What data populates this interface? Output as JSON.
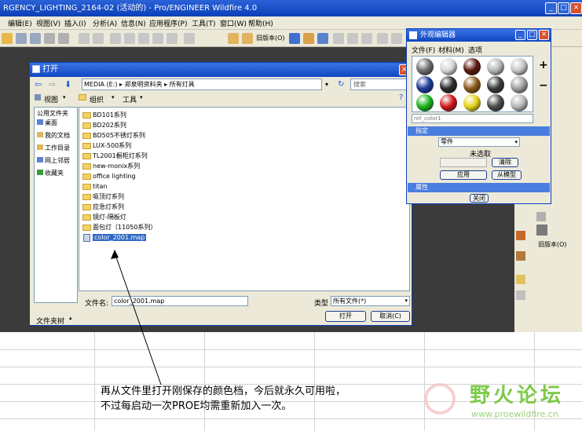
{
  "window": {
    "title": "RGENCY_LIGHTING_2164-02 (活动的) - Pro/ENGINEER Wildfire 4.0"
  },
  "menubar": [
    "编辑(E)",
    "视图(V)",
    "插入(I)",
    "分析(A)",
    "信息(N)",
    "应用程序(P)",
    "工具(T)",
    "窗口(W)",
    "帮助(H)"
  ],
  "toolbar": {
    "old_version_label": "旧版本(O)"
  },
  "open_dialog": {
    "title": "打开",
    "path": [
      "MEDIA (E:)",
      "郑泉明资料夹",
      "所有灯具"
    ],
    "search_placeholder": "搜索",
    "view_label": "视图",
    "organize_label": "组织",
    "tools_label": "工具",
    "sidebar_heading": "公用文件夹",
    "sidebar_items": [
      "桌面",
      "我的文档",
      "工作目录",
      "网上邻居",
      "收藏夹"
    ],
    "folder_tree_label": "文件夹树",
    "files": [
      {
        "name": "BD101系列",
        "type": "folder"
      },
      {
        "name": "BD202系列",
        "type": "folder"
      },
      {
        "name": "BD505不锈灯系列",
        "type": "folder"
      },
      {
        "name": "LUX-500系列",
        "type": "folder"
      },
      {
        "name": "TL2001橱柜灯系列",
        "type": "folder"
      },
      {
        "name": "new-monix系列",
        "type": "folder"
      },
      {
        "name": "office lighting",
        "type": "folder"
      },
      {
        "name": "titan",
        "type": "folder"
      },
      {
        "name": "吸顶灯系列",
        "type": "folder"
      },
      {
        "name": "应急灯系列",
        "type": "folder"
      },
      {
        "name": "镜灯-隔板灯",
        "type": "folder"
      },
      {
        "name": "面包灯（11050系列）",
        "type": "folder"
      },
      {
        "name": "color_2001.map",
        "type": "file",
        "selected": true
      }
    ],
    "filename_label": "文件名:",
    "filename_value": "color_2001.map",
    "filetype_label": "类型",
    "filetype_value": "所有文件(*)",
    "open_button": "打开",
    "cancel_button": "取消(C)"
  },
  "appearance_editor": {
    "title": "外观编辑器",
    "menu": [
      "文件(F)",
      "材料(M)",
      "选项"
    ],
    "material_name": "ref_color1",
    "assign_section": "指定",
    "part_select": "零件",
    "not_selected": "未选取",
    "clear_button": "清除",
    "apply_button": "应用",
    "from_model_button": "从模型",
    "properties_section": "属性",
    "close_button": "关闭",
    "balls": [
      "#6e6e6e",
      "#d8d8d8",
      "#5a1a0e",
      "#b7b7b7",
      "#c6c6c6",
      "#1c3a9b",
      "#2a2a2a",
      "#8a5a1a",
      "#3b3b3b",
      "#a0a0a0",
      "#1db51d",
      "#d01818",
      "#e6d21a",
      "#4b4b4b",
      "#b8b8b8"
    ]
  },
  "right_panel": {
    "old_version_label": "旧版本(O)"
  },
  "caption": {
    "line1": "再从文件里打开刚保存的颜色档，今后就永久可用啦，",
    "line2": "不过每启动一次PROE均需重新加入一次。"
  },
  "watermark": {
    "logo": "野火论坛",
    "url": "www.proewildfire.cn"
  }
}
